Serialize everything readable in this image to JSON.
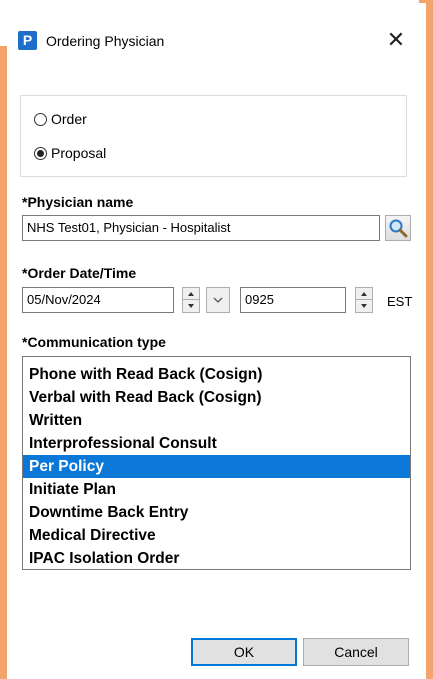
{
  "window": {
    "title": "Ordering Physician",
    "app_icon_letter": "P",
    "close_glyph": "✕"
  },
  "mode": {
    "options": [
      {
        "label": "Order",
        "selected": false
      },
      {
        "label": "Proposal",
        "selected": true
      }
    ]
  },
  "physician": {
    "label": "*Physician name",
    "value": "NHS Test01, Physician - Hospitalist",
    "search_icon": "magnifier-icon"
  },
  "order_datetime": {
    "label": "*Order Date/Time",
    "date": "05/Nov/2024",
    "time": "0925",
    "timezone": "EST"
  },
  "communication": {
    "label": "*Communication type",
    "items": [
      "Phone with Read Back (Cosign)",
      "Verbal with Read Back (Cosign)",
      "Written",
      "Interprofessional Consult",
      "Per Policy",
      "Initiate Plan",
      "Downtime Back Entry",
      "Medical Directive",
      "IPAC Isolation Order"
    ],
    "selected_index": 4
  },
  "footer": {
    "ok_label": "OK",
    "cancel_label": "Cancel"
  },
  "colors": {
    "accent": "#0078d7",
    "selection": "#0b78d7",
    "frame": "#f3a46a",
    "app_icon": "#1f6ec9"
  }
}
